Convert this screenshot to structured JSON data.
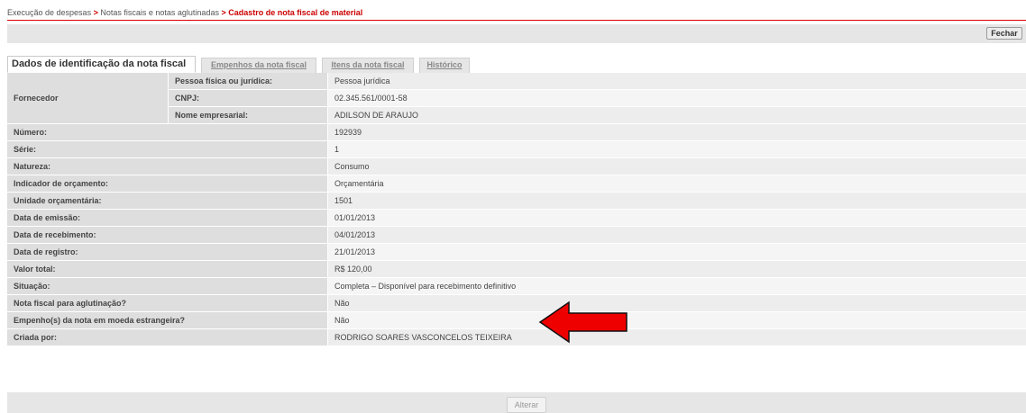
{
  "breadcrumb": {
    "items": [
      "Execução de despesas",
      "Notas fiscais e notas aglutinadas"
    ],
    "separator": ">",
    "current": "Cadastro de nota fiscal de material"
  },
  "toolbar": {
    "close_label": "Fechar"
  },
  "tabs": [
    {
      "label": "Dados de identificação da nota fiscal",
      "active": true
    },
    {
      "label": "Empenhos da nota fiscal",
      "active": false
    },
    {
      "label": "Itens da nota fiscal",
      "active": false
    },
    {
      "label": "Histórico",
      "active": false
    }
  ],
  "supplier": {
    "label": "Fornecedor",
    "rows": [
      {
        "label": "Pessoa física ou jurídica:",
        "value": "Pessoa jurídica"
      },
      {
        "label": "CNPJ:",
        "value": "02.345.561/0001-58"
      },
      {
        "label": "Nome empresarial:",
        "value": "ADILSON DE ARAUJO"
      }
    ]
  },
  "fields": [
    {
      "label": "Número:",
      "value": "192939"
    },
    {
      "label": "Série:",
      "value": "1"
    },
    {
      "label": "Natureza:",
      "value": "Consumo"
    },
    {
      "label": "Indicador de orçamento:",
      "value": "Orçamentária"
    },
    {
      "label": "Unidade orçamentária:",
      "value": "1501"
    },
    {
      "label": "Data de emissão:",
      "value": "01/01/2013"
    },
    {
      "label": "Data de recebimento:",
      "value": "04/01/2013"
    },
    {
      "label": "Data de registro:",
      "value": "21/01/2013"
    },
    {
      "label": "Valor total:",
      "value": "R$ 120,00"
    },
    {
      "label": "Situação:",
      "value": "Completa – Disponível para recebimento definitivo"
    },
    {
      "label": "Nota fiscal para aglutinação?",
      "value": "Não"
    },
    {
      "label": "Empenho(s) da nota em moeda estrangeira?",
      "value": "Não"
    },
    {
      "label": "Criada por:",
      "value": "RODRIGO SOARES VASCONCELOS TEIXEIRA"
    }
  ],
  "footer": {
    "edit_label": "Alterar"
  },
  "annotation": {
    "icon": "arrow-left-icon",
    "color": "#ee0000"
  },
  "colors": {
    "accent": "#cc0000",
    "label_bg": "#dedede",
    "value_bg": "#ededed"
  }
}
